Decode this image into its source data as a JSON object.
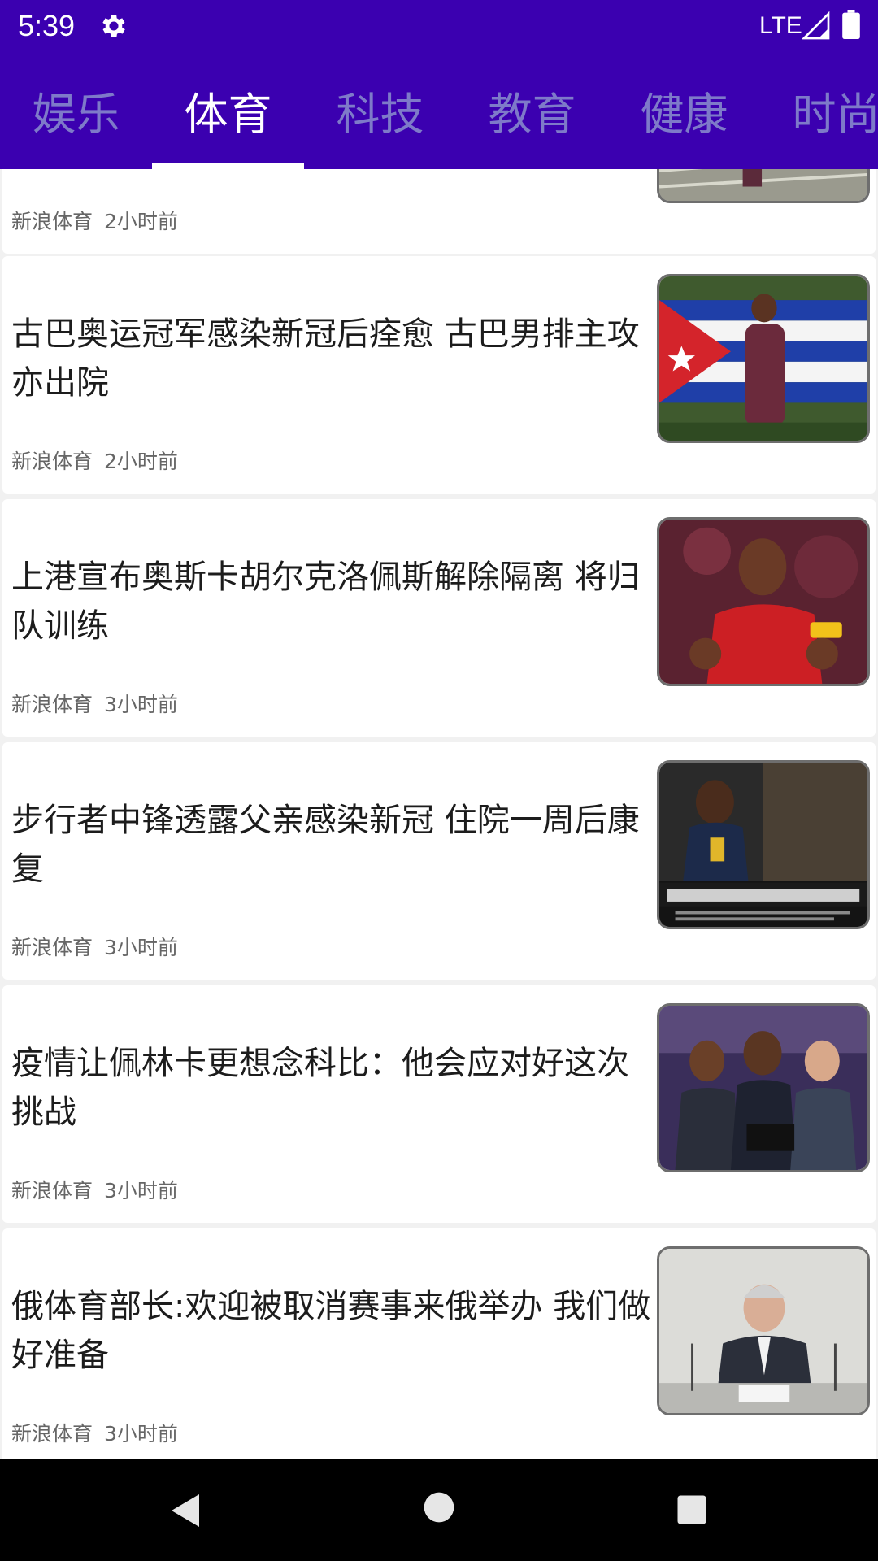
{
  "status_bar": {
    "time": "5:39",
    "network": "LTE",
    "icons": [
      "gear-icon",
      "signal-icon",
      "battery-icon"
    ]
  },
  "tabs": [
    {
      "label": "娱乐",
      "active": false
    },
    {
      "label": "体育",
      "active": true
    },
    {
      "label": "科技",
      "active": false
    },
    {
      "label": "教育",
      "active": false
    },
    {
      "label": "健康",
      "active": false
    },
    {
      "label": "时尚",
      "active": false
    }
  ],
  "colors": {
    "header": "#3b00b0",
    "tab_inactive": "#7e7ac9",
    "tab_active": "#ffffff"
  },
  "news": [
    {
      "title": "",
      "source": "新浪体育",
      "time": "2小时前",
      "thumbnail": "athletics-photo"
    },
    {
      "title": "古巴奥运冠军感染新冠后痊愈 古巴男排主攻亦出院",
      "source": "新浪体育",
      "time": "2小时前",
      "thumbnail": "wrestler-with-cuban-flag"
    },
    {
      "title": "上港宣布奥斯卡胡尔克洛佩斯解除隔离 将归队训练",
      "source": "新浪体育",
      "time": "3小时前",
      "thumbnail": "footballer-celebrating"
    },
    {
      "title": "步行者中锋透露父亲感染新冠 住院一周后康复",
      "source": "新浪体育",
      "time": "3小时前",
      "thumbnail": "basketball-player"
    },
    {
      "title": "疫情让佩林卡更想念科比：他会应对好这次挑战",
      "source": "新浪体育",
      "time": "3小时前",
      "thumbnail": "courtside-spectators"
    },
    {
      "title": "俄体育部长:欢迎被取消赛事来俄举办 我们做好准备",
      "source": "新浪体育",
      "time": "3小时前",
      "thumbnail": "press-conference"
    }
  ],
  "nav_bar": {
    "icons": [
      "back-icon",
      "home-icon",
      "recents-icon"
    ]
  }
}
